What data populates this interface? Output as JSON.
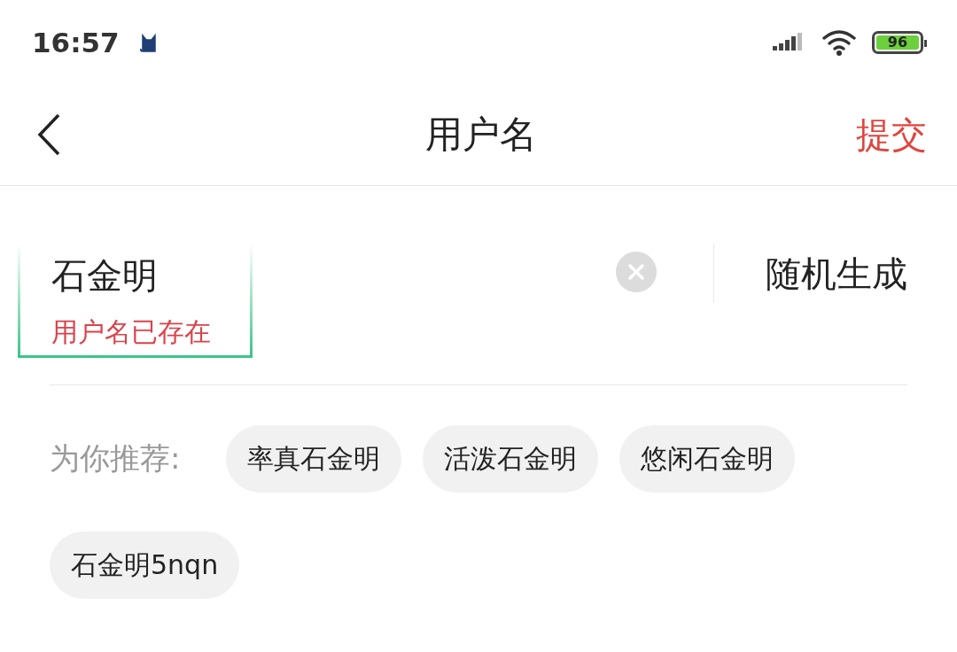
{
  "status_bar": {
    "time": "16:57",
    "battery": "96"
  },
  "header": {
    "title": "用户名",
    "submit": "提交"
  },
  "username_field": {
    "value": "石金明",
    "error": "用户名已存在",
    "random_button": "随机生成"
  },
  "recommendations": {
    "label": "为你推荐:",
    "chips": [
      {
        "label": "率真石金明"
      },
      {
        "label": "活泼石金明"
      },
      {
        "label": "悠闲石金明"
      },
      {
        "label": "石金明5nqn"
      }
    ]
  }
}
